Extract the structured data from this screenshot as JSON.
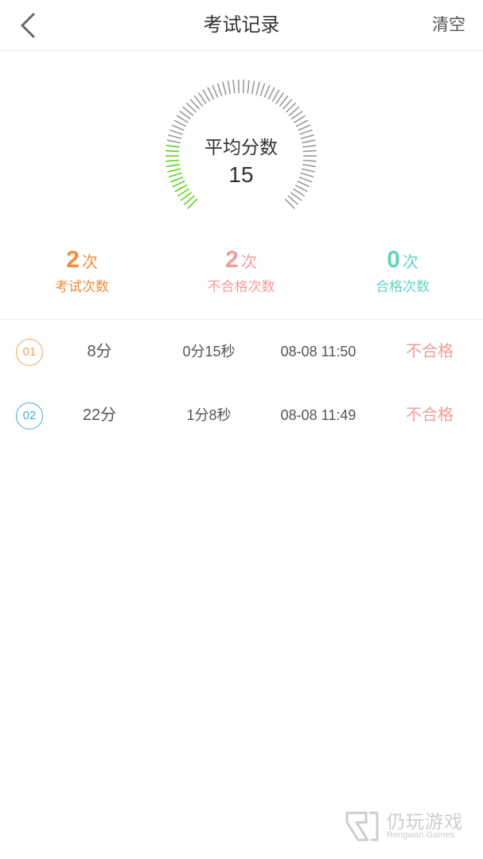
{
  "header": {
    "title": "考试记录",
    "clear_label": "清空"
  },
  "gauge": {
    "label": "平均分数",
    "value": "15",
    "fill_fraction": 0.2,
    "active_color": "#5cd41c",
    "inactive_color": "#9a9a9a"
  },
  "stats": [
    {
      "number": "2",
      "unit": "次",
      "label": "考试次数",
      "color": "#f08c3a"
    },
    {
      "number": "2",
      "unit": "次",
      "label": "不合格次数",
      "color": "#f49b9b"
    },
    {
      "number": "0",
      "unit": "次",
      "label": "合格次数",
      "color": "#5fd6bd"
    }
  ],
  "records": [
    {
      "index": "01",
      "index_color": "#f0a35a",
      "score": "8分",
      "duration": "0分15秒",
      "time": "08-08 11:50",
      "result": "不合格"
    },
    {
      "index": "02",
      "index_color": "#4aa8d8",
      "score": "22分",
      "duration": "1分8秒",
      "time": "08-08 11:49",
      "result": "不合格"
    }
  ],
  "watermark": {
    "text": "仍玩游戏",
    "sub": "Rengwan Games"
  },
  "icons": {
    "back": "chevron-left-icon",
    "watermark_logo": "rengwan-logo-icon"
  }
}
